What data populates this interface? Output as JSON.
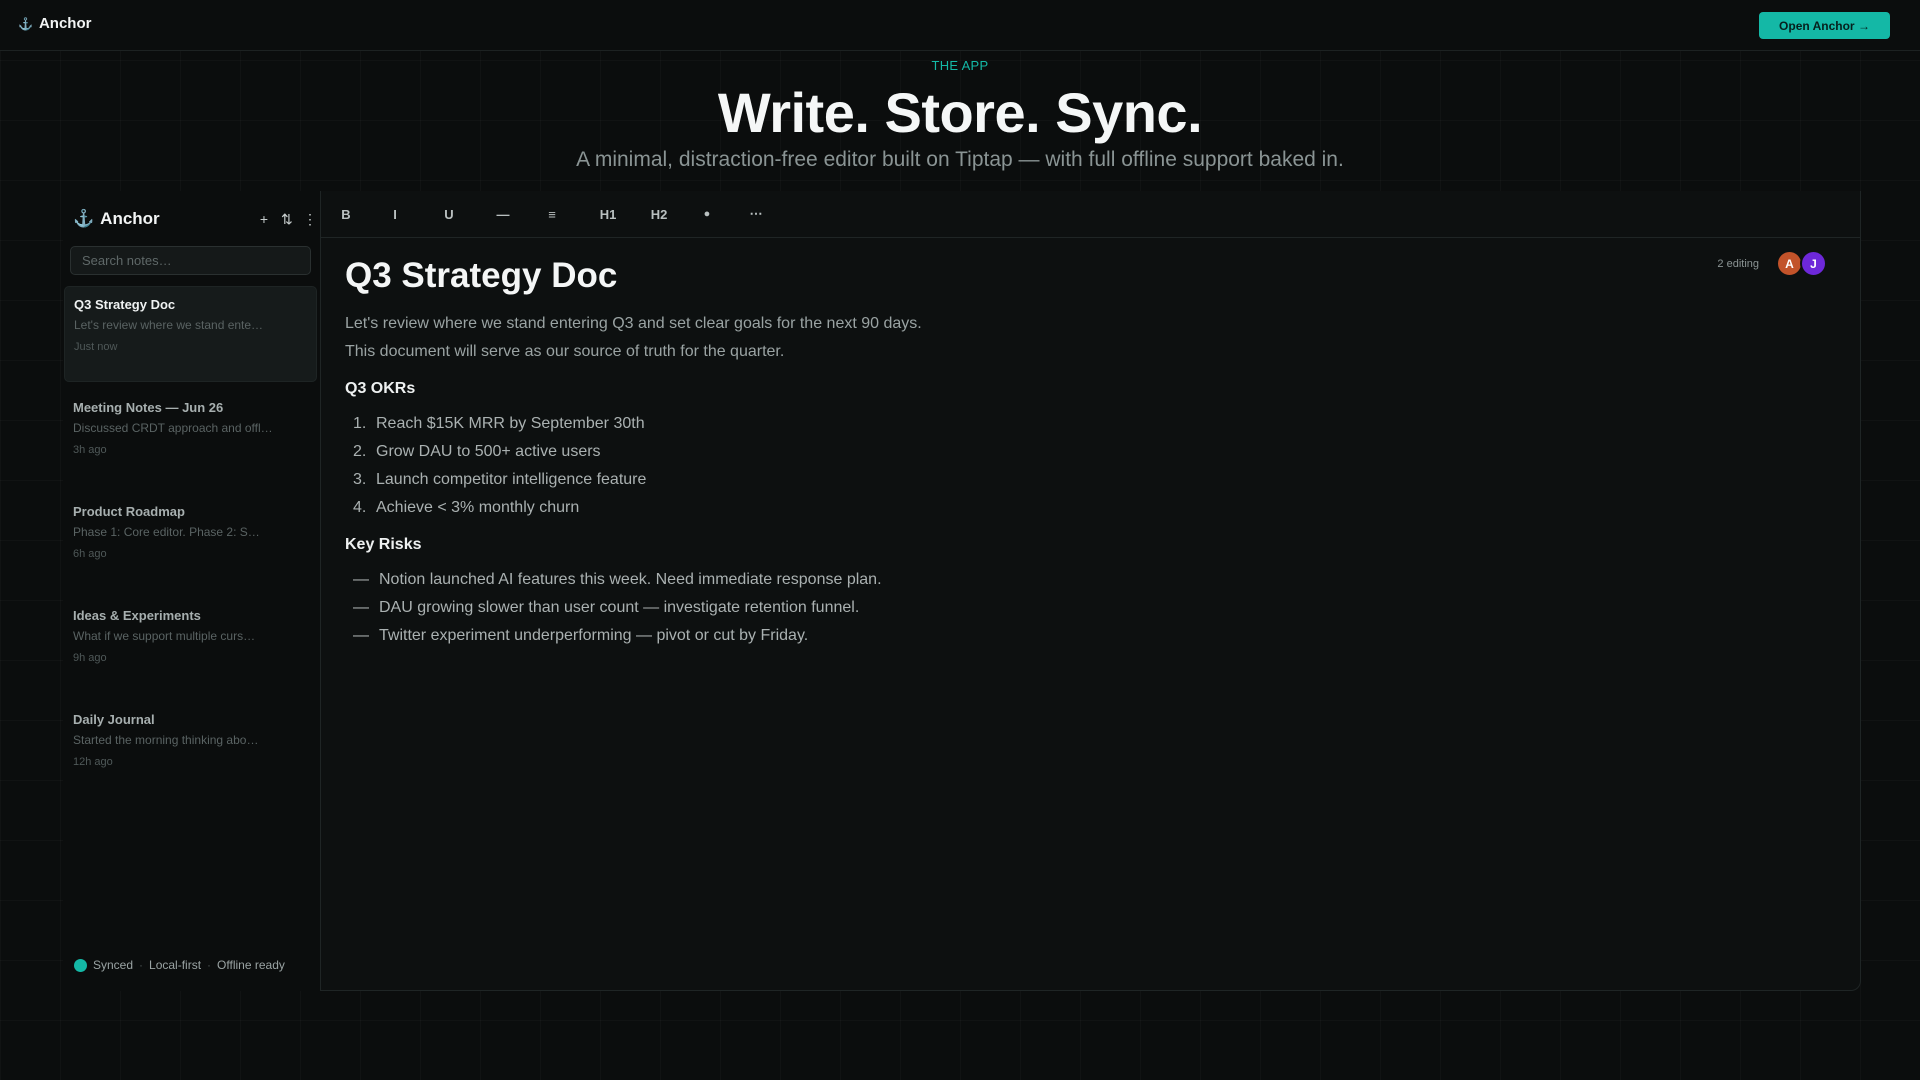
{
  "topbar": {
    "brand_icon": "⚓",
    "brand": "Anchor",
    "cta": "Open Anchor →"
  },
  "hero": {
    "eyebrow": "THE APP",
    "title": "Write. Store. Sync.",
    "subtitle": "A minimal, distraction-free editor built on Tiptap — with full offline support baked in."
  },
  "sidebar": {
    "brand_icon": "⚓",
    "brand": "Anchor",
    "actions": [
      "+",
      "⇅",
      "⋮"
    ],
    "search_placeholder": "Search notes…",
    "notes": [
      {
        "title": "Q3 Strategy Doc",
        "preview": "Let's review where we stand ente…",
        "time": "Just now",
        "active": true
      },
      {
        "title": "Meeting Notes — Jun 26",
        "preview": "Discussed CRDT approach and offl…",
        "time": "3h ago"
      },
      {
        "title": "Product Roadmap",
        "preview": "Phase 1: Core editor. Phase 2: S…",
        "time": "6h ago"
      },
      {
        "title": "Ideas & Experiments",
        "preview": "What if we support multiple curs…",
        "time": "9h ago"
      },
      {
        "title": "Daily Journal",
        "preview": "Started the morning thinking abo…",
        "time": "12h ago"
      }
    ],
    "status": {
      "synced": "Synced",
      "local": "Local-first",
      "offline": "Offline ready",
      "separator": "·",
      "dot_color": "#14b8a6"
    }
  },
  "toolbar": {
    "bold": "B",
    "italic": "I",
    "underline": "U",
    "rule": "—",
    "list": "≡",
    "h1": "H1",
    "h2": "H2",
    "bullet": "●",
    "more": "⋯"
  },
  "presence": {
    "label": "2 editing",
    "avatars": [
      {
        "initial": "A",
        "color": "#c2532a"
      },
      {
        "initial": "J",
        "color": "#6d28d9"
      }
    ]
  },
  "document": {
    "title": "Q3 Strategy Doc",
    "intro": [
      "Let's review where we stand entering Q3 and set clear goals for the next 90 days.",
      "This document will serve as our source of truth for the quarter."
    ],
    "okr_heading": "Q3 OKRs",
    "okrs": [
      "Reach $15K MRR by September 30th",
      "Grow DAU to 500+ active users",
      "Launch competitor intelligence feature",
      "Achieve < 3% monthly churn"
    ],
    "risks_heading": "Key Risks",
    "risks": [
      "Notion launched AI features this week. Need immediate response plan.",
      "DAU growing slower than user count — investigate retention funnel.",
      "Twitter experiment underperforming — pivot or cut by Friday."
    ]
  },
  "colors": {
    "accent": "#14b8a6",
    "background": "#0b0d0d"
  }
}
